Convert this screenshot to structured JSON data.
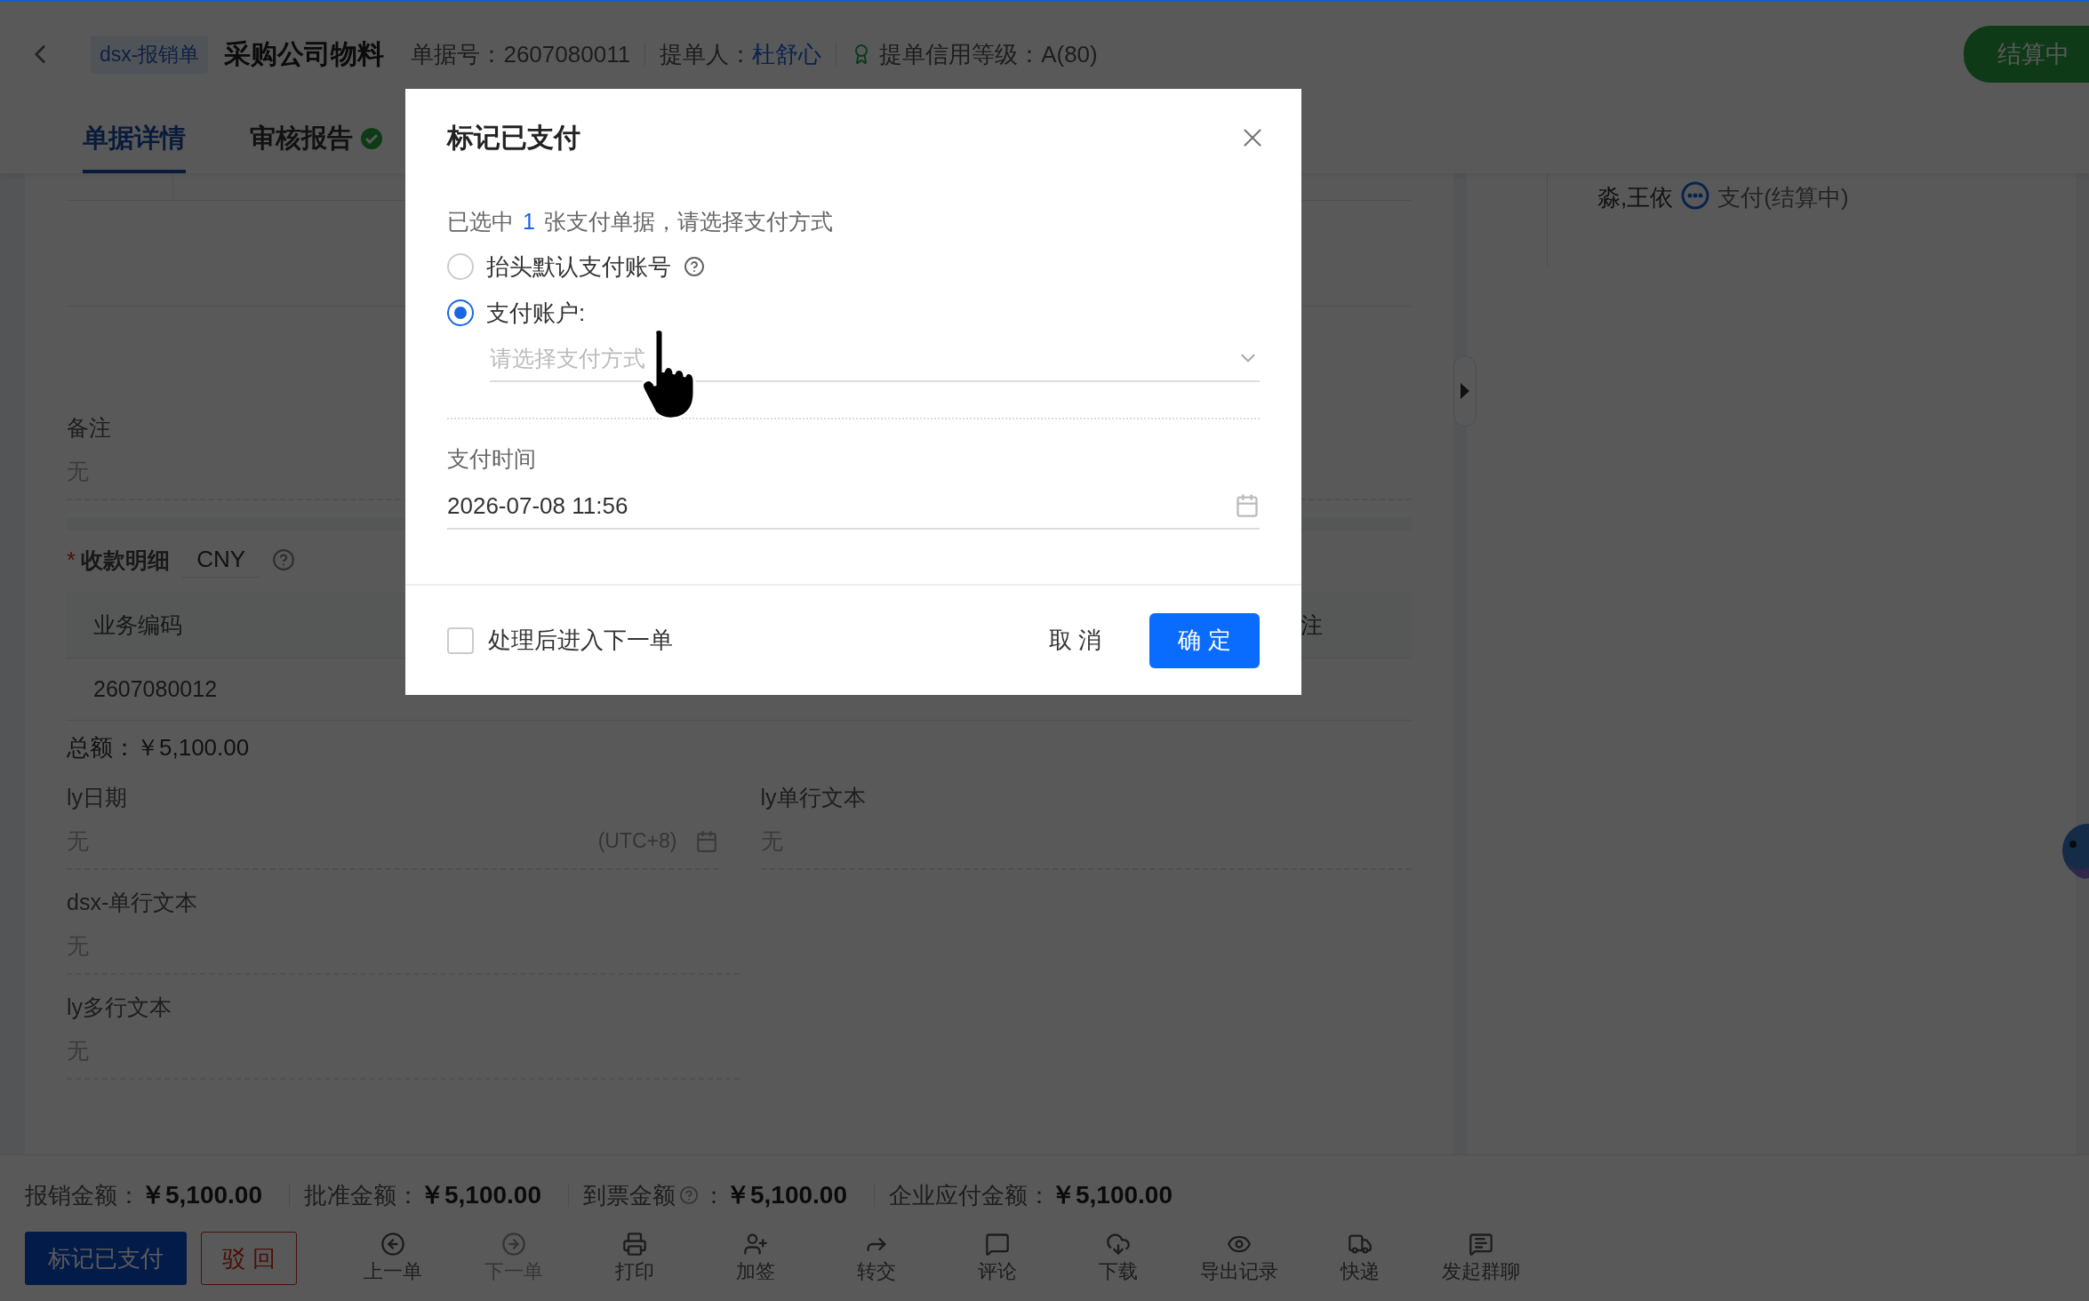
{
  "header": {
    "tag": "dsx-报销单",
    "title": "采购公司物料",
    "meta": [
      {
        "label": "单据号：",
        "value": "2607080011",
        "kind": "plain"
      },
      {
        "label": "提单人：",
        "value": "杜舒心",
        "kind": "link"
      },
      {
        "label": "提单信用等级：",
        "value": "A(80)",
        "kind": "badge"
      }
    ],
    "status": "结算中"
  },
  "tabs": [
    {
      "label": "单据详情",
      "selected": true,
      "verified": false
    },
    {
      "label": "审核报告",
      "selected": false,
      "verified": true
    }
  ],
  "remark": {
    "label": "备注",
    "value": "无"
  },
  "receipt": {
    "label": "收款明细",
    "required_mark": "*",
    "currency": "CNY",
    "columns": [
      "业务编码",
      "注"
    ],
    "rows": [
      [
        "2607080012"
      ]
    ],
    "total": "总额：￥5,100.00"
  },
  "field_rows": [
    [
      {
        "label": "ly日期",
        "value": "无",
        "kind": "date",
        "suffix": "(UTC+8)"
      },
      {
        "label": "ly单行文本",
        "value": "无",
        "kind": "text"
      }
    ],
    [
      {
        "label": "dsx-单行文本",
        "value": "无",
        "kind": "text"
      }
    ],
    [
      {
        "label": "ly多行文本",
        "value": "无",
        "kind": "text"
      }
    ]
  ],
  "approval": {
    "names": "淼,王依",
    "status": "支付(结算中)"
  },
  "amounts": [
    {
      "label": "报销金额：",
      "value": "￥5,100.00",
      "help": false
    },
    {
      "label": "批准金额：",
      "value": "￥5,100.00",
      "help": false
    },
    {
      "label": "到票金额",
      "label_suffix": "：",
      "value": "￥5,100.00",
      "help": true
    },
    {
      "label": "企业应付金额：",
      "value": "￥5,100.00",
      "help": false
    }
  ],
  "actions": {
    "primary": "标记已支付",
    "reject": "驳 回",
    "tools": [
      {
        "label": "上一单",
        "disabled": false
      },
      {
        "label": "下一单",
        "disabled": true
      },
      {
        "label": "打印",
        "disabled": false
      },
      {
        "label": "加签",
        "disabled": false
      },
      {
        "label": "转交",
        "disabled": false
      },
      {
        "label": "评论",
        "disabled": false
      },
      {
        "label": "下载",
        "disabled": false
      },
      {
        "label": "导出记录",
        "disabled": false
      },
      {
        "label": "快递",
        "disabled": false
      },
      {
        "label": "发起群聊",
        "disabled": false
      }
    ]
  },
  "dialog": {
    "title": "标记已支付",
    "summary": {
      "before": "已选中",
      "count": "1",
      "after": "张支付单据，请选择支付方式"
    },
    "options": [
      {
        "label": "抬头默认支付账号",
        "selected": false,
        "help": true
      },
      {
        "label": "支付账户:",
        "selected": true,
        "help": false,
        "placeholder": "请选择支付方式"
      }
    ],
    "time": {
      "label": "支付时间",
      "value": "2026-07-08 11:56"
    },
    "next": {
      "label": "处理后进入下一单",
      "checked": false
    },
    "cancel": "取 消",
    "confirm": "确 定"
  }
}
